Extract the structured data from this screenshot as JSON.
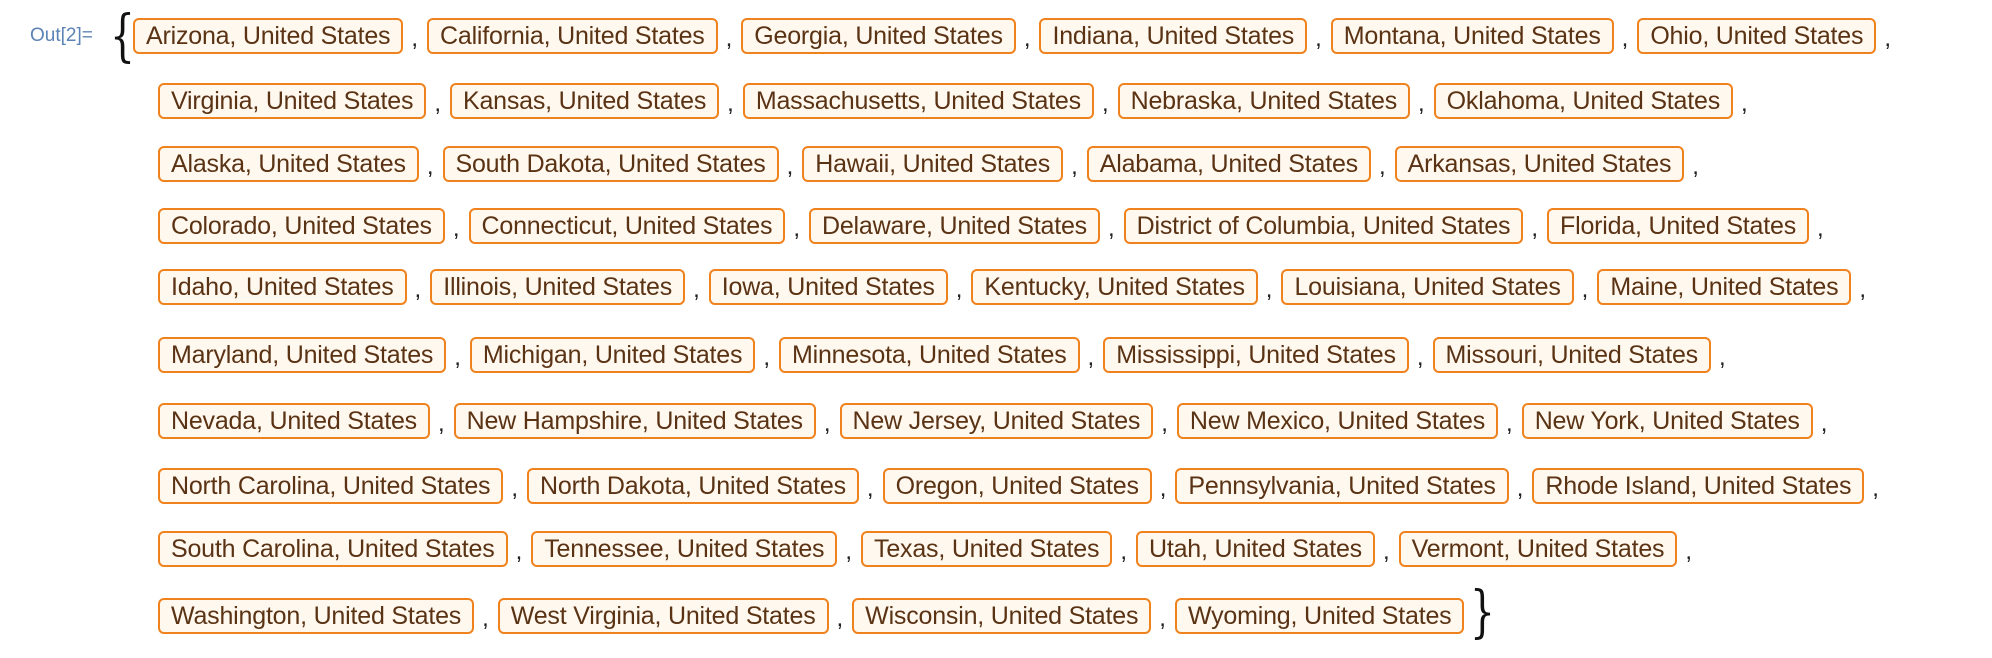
{
  "output_label": "Out[2]=",
  "open_brace": "{",
  "close_brace": "}",
  "separator": ",",
  "rows": [
    [
      "Arizona, United States",
      "California, United States",
      "Georgia, United States",
      "Indiana, United States",
      "Montana, United States",
      "Ohio, United States"
    ],
    [
      "Virginia, United States",
      "Kansas, United States",
      "Massachusetts, United States",
      "Nebraska, United States",
      "Oklahoma, United States"
    ],
    [
      "Alaska, United States",
      "South Dakota, United States",
      "Hawaii, United States",
      "Alabama, United States",
      "Arkansas, United States"
    ],
    [
      "Colorado, United States",
      "Connecticut, United States",
      "Delaware, United States",
      "District of Columbia, United States",
      "Florida, United States"
    ],
    [
      "Idaho, United States",
      "Illinois, United States",
      "Iowa, United States",
      "Kentucky, United States",
      "Louisiana, United States",
      "Maine, United States"
    ],
    [
      "Maryland, United States",
      "Michigan, United States",
      "Minnesota, United States",
      "Mississippi, United States",
      "Missouri, United States"
    ],
    [
      "Nevada, United States",
      "New Hampshire, United States",
      "New Jersey, United States",
      "New Mexico, United States",
      "New York, United States"
    ],
    [
      "North Carolina, United States",
      "North Dakota, United States",
      "Oregon, United States",
      "Pennsylvania, United States",
      "Rhode Island, United States"
    ],
    [
      "South Carolina, United States",
      "Tennessee, United States",
      "Texas, United States",
      "Utah, United States",
      "Vermont, United States"
    ],
    [
      "Washington, United States",
      "West Virginia, United States",
      "Wisconsin, United States",
      "Wyoming, United States"
    ]
  ],
  "colors": {
    "entity_border": "#f0821e",
    "entity_fill": "#fff8ee",
    "entity_text": "#5a3214",
    "label_text": "#5b83b5"
  }
}
